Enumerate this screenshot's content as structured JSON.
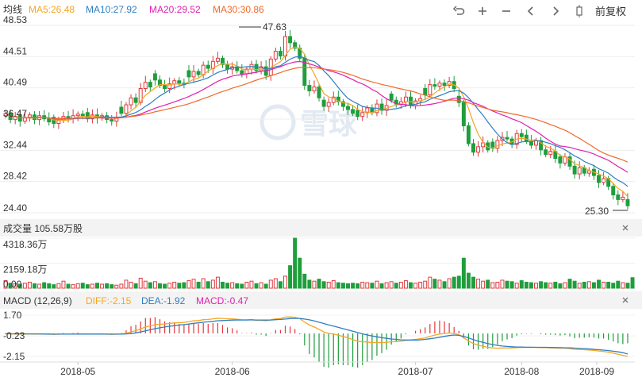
{
  "legend_main": {
    "title": "均线",
    "items": [
      {
        "label": "MA5:26.48",
        "color": "#f5a623"
      },
      {
        "label": "MA10:27.92",
        "color": "#2f7ec2"
      },
      {
        "label": "MA20:29.52",
        "color": "#e020b0"
      },
      {
        "label": "MA30:30.86",
        "color": "#f06a2c"
      }
    ]
  },
  "toolbar": {
    "undo_icon": "undo-icon",
    "zoom_in_icon": "plus-icon",
    "zoom_out_icon": "minus-icon",
    "prev_icon": "chevron-left-icon",
    "next_icon": "chevron-right-icon",
    "candle_icon": "candlestick-icon",
    "adjust_label": "前复权"
  },
  "price_axis": [
    "48.53",
    "44.51",
    "40.49",
    "36.47",
    "32.44",
    "28.42",
    "24.40"
  ],
  "annotations": {
    "high": "47.63",
    "low": "25.30"
  },
  "watermark": "雪球",
  "volume": {
    "title": "成交量 105.58万股",
    "axis": [
      "4318.36万",
      "2159.18万",
      "0.00"
    ]
  },
  "macd": {
    "title": "MACD (12,26,9)",
    "diff_label": "DIFF:-2.15",
    "dea_label": "DEA:-1.92",
    "macd_label": "MACD:-0.47",
    "axis": [
      "1.70",
      "-0.23",
      "-2.15"
    ]
  },
  "x_axis": [
    "2018-05",
    "2018-06",
    "2018-07",
    "2018-08",
    "2018-09"
  ],
  "colors": {
    "up": "#e0393e",
    "down": "#1e9e3c",
    "ma5": "#f5a623",
    "ma10": "#2f7ec2",
    "ma20": "#e020b0",
    "ma30": "#f06a2c",
    "diff": "#f5a623",
    "dea": "#2f7ec2"
  },
  "chart_data": {
    "type": "candlestick",
    "y_range": [
      24.4,
      48.53
    ],
    "x_ticks": [
      "2018-05",
      "2018-06",
      "2018-07",
      "2018-08",
      "2018-09"
    ],
    "max_price_label": 47.63,
    "min_price_label": 25.3,
    "close_series": [
      37.2,
      36.4,
      36.8,
      36.2,
      36.6,
      37.0,
      36.4,
      36.9,
      36.5,
      36.1,
      35.9,
      36.3,
      36.8,
      36.5,
      36.9,
      37.1,
      36.8,
      36.5,
      37.0,
      36.6,
      36.9,
      36.4,
      36.2,
      36.7,
      37.2,
      38.3,
      39.2,
      38.6,
      40.4,
      41.2,
      40.6,
      41.5,
      40.8,
      40.4,
      41.0,
      41.4,
      41.1,
      40.9,
      41.9,
      42.6,
      42.2,
      43.4,
      43.0,
      43.9,
      44.3,
      43.5,
      42.9,
      43.2,
      42.7,
      42.3,
      42.9,
      43.5,
      42.7,
      43.2,
      42.1,
      44.2,
      45.2,
      44.6,
      47.1,
      46.3,
      45.6,
      44.3,
      40.8,
      40.1,
      40.6,
      39.2,
      38.1,
      38.6,
      39.3,
      38.7,
      38.1,
      37.7,
      37.2,
      36.8,
      37.3,
      37.9,
      37.3,
      38.4,
      37.6,
      38.2,
      38.9,
      38.4,
      38.7,
      39.3,
      38.2,
      38.8,
      39.1,
      39.6,
      40.9,
      40.7,
      41.1,
      40.8,
      41.3,
      40.4,
      38.6,
      35.6,
      33.3,
      32.2,
      32.9,
      33.4,
      32.5,
      32.7,
      33.7,
      34.1,
      33.9,
      33.2,
      34.6,
      34.2,
      33.6,
      33.1,
      33.7,
      32.5,
      31.9,
      32.3,
      31.4,
      30.8,
      31.6,
      30.4,
      29.4,
      30.2,
      29.5,
      29.8,
      29.2,
      28.3,
      28.8,
      27.8,
      26.7,
      26.1,
      26.4,
      25.3
    ],
    "volume_series": [
      15,
      10,
      9,
      8,
      10,
      12,
      9,
      8,
      11,
      9,
      7,
      9,
      14,
      8,
      7,
      9,
      10,
      7,
      8,
      10,
      8,
      9,
      7,
      6,
      8,
      16,
      12,
      9,
      20,
      14,
      11,
      13,
      9,
      8,
      10,
      12,
      10,
      11,
      15,
      18,
      12,
      19,
      13,
      16,
      22,
      12,
      10,
      11,
      9,
      8,
      12,
      14,
      9,
      11,
      8,
      16,
      19,
      13,
      24,
      45,
      100,
      60,
      28,
      16,
      14,
      18,
      13,
      12,
      15,
      11,
      10,
      9,
      10,
      9,
      12,
      11,
      10,
      14,
      9,
      11,
      13,
      10,
      12,
      15,
      11,
      10,
      12,
      14,
      22,
      18,
      16,
      13,
      19,
      22,
      24,
      60,
      30,
      22,
      18,
      14,
      16,
      11,
      12,
      16,
      14,
      13,
      10,
      15,
      12,
      11,
      10,
      13,
      11,
      10,
      12,
      9,
      11,
      18,
      14,
      10,
      12,
      13,
      11,
      16,
      12,
      12,
      10,
      14,
      11,
      10,
      21
    ],
    "macd_diff": [
      -0.05,
      -0.05,
      -0.06,
      -0.06,
      -0.06,
      -0.05,
      -0.07,
      -0.06,
      -0.07,
      -0.08,
      -0.09,
      -0.08,
      -0.06,
      -0.07,
      -0.06,
      -0.05,
      -0.06,
      -0.07,
      -0.06,
      -0.07,
      -0.06,
      -0.08,
      -0.09,
      -0.08,
      -0.06,
      0.02,
      0.15,
      0.25,
      0.42,
      0.6,
      0.7,
      0.82,
      0.85,
      0.88,
      0.92,
      0.98,
      1.0,
      1.02,
      1.1,
      1.18,
      1.2,
      1.28,
      1.3,
      1.36,
      1.42,
      1.4,
      1.36,
      1.36,
      1.32,
      1.26,
      1.26,
      1.28,
      1.22,
      1.22,
      1.18,
      1.26,
      1.36,
      1.38,
      1.52,
      1.54,
      1.5,
      1.38,
      1.06,
      0.78,
      0.6,
      0.38,
      0.14,
      0.0,
      -0.06,
      -0.16,
      -0.3,
      -0.42,
      -0.58,
      -0.72,
      -0.78,
      -0.8,
      -0.86,
      -0.84,
      -0.86,
      -0.84,
      -0.78,
      -0.76,
      -0.72,
      -0.64,
      -0.62,
      -0.56,
      -0.5,
      -0.42,
      -0.28,
      -0.16,
      -0.06,
      0.0,
      0.04,
      0.0,
      -0.12,
      -0.4,
      -0.7,
      -0.95,
      -1.1,
      -1.2,
      -1.3,
      -1.36,
      -1.38,
      -1.36,
      -1.36,
      -1.36,
      -1.32,
      -1.3,
      -1.3,
      -1.3,
      -1.3,
      -1.32,
      -1.33,
      -1.34,
      -1.36,
      -1.38,
      -1.38,
      -1.42,
      -1.48,
      -1.5,
      -1.52,
      -1.54,
      -1.58,
      -1.64,
      -1.68,
      -1.75,
      -1.85,
      -1.95,
      -2.05,
      -2.15
    ],
    "macd_dea": [
      -0.03,
      -0.03,
      -0.04,
      -0.04,
      -0.04,
      -0.05,
      -0.05,
      -0.05,
      -0.06,
      -0.06,
      -0.07,
      -0.07,
      -0.07,
      -0.07,
      -0.07,
      -0.07,
      -0.06,
      -0.06,
      -0.06,
      -0.06,
      -0.06,
      -0.07,
      -0.07,
      -0.07,
      -0.07,
      -0.05,
      -0.02,
      0.05,
      0.14,
      0.24,
      0.34,
      0.44,
      0.52,
      0.6,
      0.66,
      0.72,
      0.78,
      0.82,
      0.88,
      0.94,
      0.98,
      1.04,
      1.08,
      1.12,
      1.18,
      1.2,
      1.22,
      1.24,
      1.25,
      1.25,
      1.25,
      1.26,
      1.25,
      1.25,
      1.24,
      1.25,
      1.28,
      1.3,
      1.34,
      1.38,
      1.4,
      1.4,
      1.34,
      1.26,
      1.16,
      1.04,
      0.92,
      0.8,
      0.68,
      0.56,
      0.44,
      0.32,
      0.2,
      0.08,
      -0.04,
      -0.14,
      -0.24,
      -0.32,
      -0.4,
      -0.46,
      -0.52,
      -0.56,
      -0.6,
      -0.62,
      -0.62,
      -0.62,
      -0.6,
      -0.56,
      -0.5,
      -0.44,
      -0.36,
      -0.28,
      -0.2,
      -0.15,
      -0.18,
      -0.28,
      -0.42,
      -0.58,
      -0.72,
      -0.84,
      -0.94,
      -1.04,
      -1.12,
      -1.18,
      -1.22,
      -1.25,
      -1.27,
      -1.28,
      -1.29,
      -1.29,
      -1.3,
      -1.3,
      -1.3,
      -1.31,
      -1.32,
      -1.33,
      -1.34,
      -1.35,
      -1.37,
      -1.4,
      -1.42,
      -1.45,
      -1.48,
      -1.52,
      -1.56,
      -1.6,
      -1.66,
      -1.72,
      -1.8,
      -1.92
    ]
  }
}
